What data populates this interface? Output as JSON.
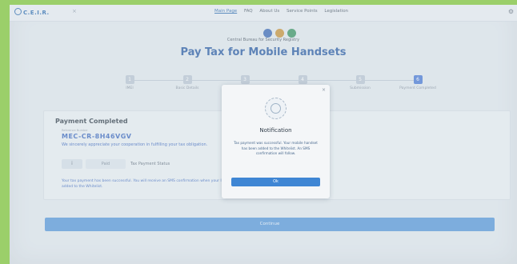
{
  "header": {
    "brand": "C.E.I.R.",
    "close": "×",
    "nav": [
      "Main Page",
      "FAQ",
      "About Us",
      "Service Points",
      "Legislation"
    ]
  },
  "agency": {
    "name": "Central Bureau for Security Registry"
  },
  "page": {
    "title": "Pay Tax for Mobile Handsets"
  },
  "steps": [
    {
      "num": "1",
      "label": "IMEI"
    },
    {
      "num": "2",
      "label": "Basic Details"
    },
    {
      "num": "3",
      "label": ""
    },
    {
      "num": "4",
      "label": ""
    },
    {
      "num": "5",
      "label": "Submission"
    },
    {
      "num": "6",
      "label": "Payment Completed"
    }
  ],
  "payment": {
    "title": "Payment Completed",
    "ref_label": "Reference Number",
    "ref_value": "MEC-CR-8H46VGV",
    "thanks": "We sincerely appreciate your cooperation in fulfilling your tax obligation.",
    "status_icon": "i",
    "status_pill": "Paid",
    "status_text": "Tax Payment Status",
    "success": "Your tax payment has been successful. You will receive an SMS confirmation when your IMEI has been added to the Whitelist."
  },
  "continue_label": "Continue",
  "modal": {
    "close": "×",
    "title": "Notification",
    "body": "Tax payment was successful. Your mobile handset has been added to the Whitelist. An SMS confirmation will follow.",
    "ok": "Ok"
  },
  "colors": {
    "accent": "#3b6fd1",
    "brand": "#1a5ea8",
    "button": "#4a8fd6"
  }
}
